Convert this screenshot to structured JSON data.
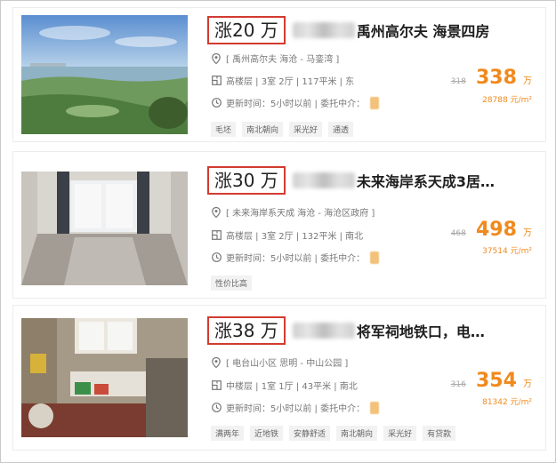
{
  "listings": [
    {
      "raise_label": "涨20 万",
      "title": "禹州高尔夫 海景四房",
      "community": "[ 禹州高尔夫 海沧 - 马銮湾 ]",
      "details": "高楼层 | 3室 2厅 | 117平米 | 东",
      "updated": "更新时间：5小时以前 | 委托中介：",
      "tags": [
        "毛坯",
        "南北朝向",
        "采光好",
        "通透"
      ],
      "old_price": "318",
      "price": "338",
      "price_unit": "万",
      "unit_price": "28788 元/m²"
    },
    {
      "raise_label": "涨30 万",
      "title": "未来海岸系天成3居…",
      "community": "[ 未来海岸系天成 海沧 - 海沧区政府 ]",
      "details": "高楼层 | 3室 2厅 | 132平米 | 南北",
      "updated": "更新时间：5小时以前 | 委托中介：",
      "tags": [
        "性价比高"
      ],
      "old_price": "468",
      "price": "498",
      "price_unit": "万",
      "unit_price": "37514 元/m²"
    },
    {
      "raise_label": "涨38 万",
      "title": "将军祠地铁口，电…",
      "community": "[ 电台山小区 思明 - 中山公园 ]",
      "details": "中楼层 | 1室 1厅 | 43平米 | 南北",
      "updated": "更新时间：5小时以前 | 委托中介：",
      "tags": [
        "满两年",
        "近地铁",
        "安静舒适",
        "南北朝向",
        "采光好",
        "有贷款"
      ],
      "old_price": "316",
      "price": "354",
      "price_unit": "万",
      "unit_price": "81342 元/m²"
    }
  ],
  "icons": {
    "location": "location-pin-icon",
    "floor": "floor-plan-icon",
    "time": "clock-icon"
  },
  "colors": {
    "accent": "#f08a1e",
    "badge_border": "#d23b2f"
  }
}
